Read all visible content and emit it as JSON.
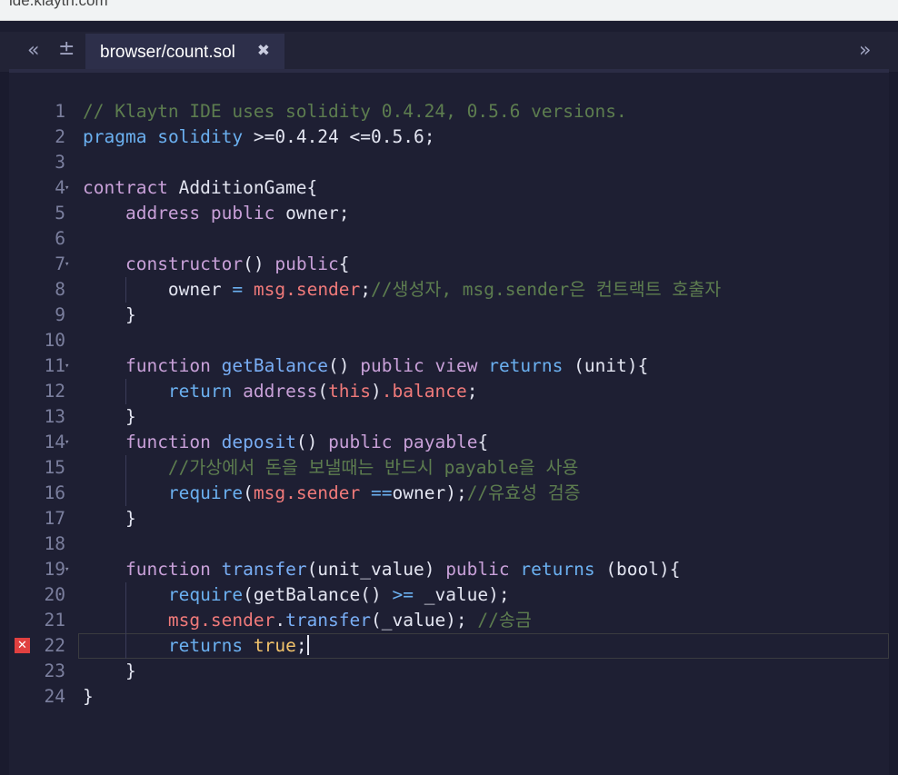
{
  "browser": {
    "url": "ide.klaytn.com"
  },
  "toolbar": {
    "collapse_icon": "double-chevron-left-icon",
    "add_icon": "plus-minus-icon",
    "expand_icon": "double-chevron-right-icon"
  },
  "tab": {
    "label": "browser/count.sol",
    "close_glyph": "✖"
  },
  "editor": {
    "error_line": 22,
    "lines": [
      [
        [
          "c-comment",
          "// Klaytn IDE uses solidity 0.4.24, 0.5.6 versions."
        ]
      ],
      [
        [
          "c-kw2",
          "pragma"
        ],
        [
          "c-plain",
          " "
        ],
        [
          "c-kw2",
          "solidity"
        ],
        [
          "c-plain",
          " >=0.4.24 <=0.5.6;"
        ]
      ],
      [],
      [
        [
          "c-kw",
          "contract"
        ],
        [
          "c-plain",
          " AdditionGame{"
        ]
      ],
      [
        [
          "c-plain",
          "    "
        ],
        [
          "c-kw",
          "address"
        ],
        [
          "c-plain",
          " "
        ],
        [
          "c-kw",
          "public"
        ],
        [
          "c-plain",
          " owner;"
        ]
      ],
      [],
      [
        [
          "c-plain",
          "    "
        ],
        [
          "c-kw",
          "constructor"
        ],
        [
          "c-plain",
          "() "
        ],
        [
          "c-kw",
          "public"
        ],
        [
          "c-plain",
          "{"
        ]
      ],
      [
        [
          "c-plain",
          "        owner "
        ],
        [
          "c-op",
          "="
        ],
        [
          "c-plain",
          " "
        ],
        [
          "c-red",
          "msg.sender"
        ],
        [
          "c-plain",
          ";"
        ],
        [
          "c-comment",
          "//생성자, msg.sender은 컨트랙트 호출자"
        ]
      ],
      [
        [
          "c-plain",
          "    }"
        ]
      ],
      [],
      [
        [
          "c-plain",
          "    "
        ],
        [
          "c-kw",
          "function"
        ],
        [
          "c-plain",
          " "
        ],
        [
          "c-fn",
          "getBalance"
        ],
        [
          "c-plain",
          "() "
        ],
        [
          "c-kw",
          "public"
        ],
        [
          "c-plain",
          " "
        ],
        [
          "c-kw",
          "view"
        ],
        [
          "c-plain",
          " "
        ],
        [
          "c-kw2",
          "returns"
        ],
        [
          "c-plain",
          " (unit){"
        ]
      ],
      [
        [
          "c-plain",
          "        "
        ],
        [
          "c-kw2",
          "return"
        ],
        [
          "c-plain",
          " "
        ],
        [
          "c-kw",
          "address"
        ],
        [
          "c-plain",
          "("
        ],
        [
          "c-red",
          "this"
        ],
        [
          "c-plain",
          ")"
        ],
        [
          "c-red",
          ".balance"
        ],
        [
          "c-plain",
          ";"
        ]
      ],
      [
        [
          "c-plain",
          "    }"
        ]
      ],
      [
        [
          "c-plain",
          "    "
        ],
        [
          "c-kw",
          "function"
        ],
        [
          "c-plain",
          " "
        ],
        [
          "c-fn",
          "deposit"
        ],
        [
          "c-plain",
          "() "
        ],
        [
          "c-kw",
          "public"
        ],
        [
          "c-plain",
          " "
        ],
        [
          "c-kw",
          "payable"
        ],
        [
          "c-plain",
          "{"
        ]
      ],
      [
        [
          "c-plain",
          "        "
        ],
        [
          "c-comment",
          "//가상에서 돈을 보낼때는 반드시 payable을 사용"
        ]
      ],
      [
        [
          "c-plain",
          "        "
        ],
        [
          "c-kw2",
          "require"
        ],
        [
          "c-plain",
          "("
        ],
        [
          "c-red",
          "msg.sender"
        ],
        [
          "c-plain",
          " "
        ],
        [
          "c-op",
          "=="
        ],
        [
          "c-plain",
          "owner);"
        ],
        [
          "c-comment",
          "//유효성 검증"
        ]
      ],
      [
        [
          "c-plain",
          "    }"
        ]
      ],
      [],
      [
        [
          "c-plain",
          "    "
        ],
        [
          "c-kw",
          "function"
        ],
        [
          "c-plain",
          " "
        ],
        [
          "c-fn",
          "transfer"
        ],
        [
          "c-plain",
          "(unit_value) "
        ],
        [
          "c-kw",
          "public"
        ],
        [
          "c-plain",
          " "
        ],
        [
          "c-kw2",
          "returns"
        ],
        [
          "c-plain",
          " (bool){"
        ]
      ],
      [
        [
          "c-plain",
          "        "
        ],
        [
          "c-kw2",
          "require"
        ],
        [
          "c-plain",
          "(getBalance() "
        ],
        [
          "c-op",
          ">="
        ],
        [
          "c-plain",
          " _value);"
        ]
      ],
      [
        [
          "c-plain",
          "        "
        ],
        [
          "c-red",
          "msg.sender"
        ],
        [
          "c-plain",
          "."
        ],
        [
          "c-fn",
          "transfer"
        ],
        [
          "c-plain",
          "(_value); "
        ],
        [
          "c-comment",
          "//송금"
        ]
      ],
      [
        [
          "c-plain",
          "        "
        ],
        [
          "c-kw2",
          "returns"
        ],
        [
          "c-plain",
          " "
        ],
        [
          "c-bool",
          "true"
        ],
        [
          "c-plain",
          ";"
        ]
      ],
      [
        [
          "c-plain",
          "    }"
        ]
      ],
      [
        [
          "c-plain",
          "}"
        ]
      ]
    ],
    "fold_lines": [
      4,
      7,
      11,
      14,
      19
    ]
  }
}
